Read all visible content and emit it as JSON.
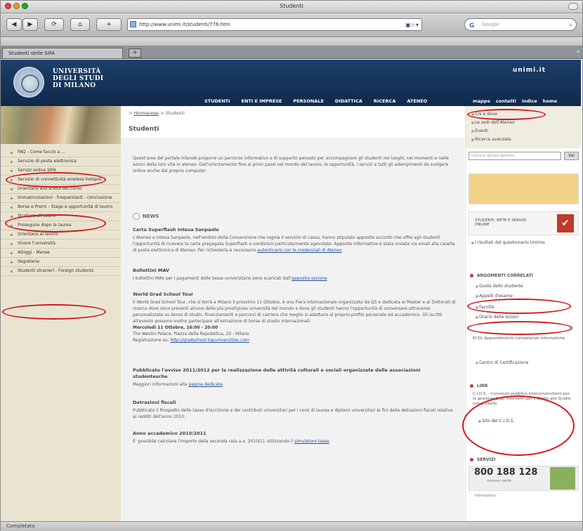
{
  "window": {
    "title": "Studenti"
  },
  "toolbar": {
    "back": "◀",
    "forward": "▶",
    "reload": "⟳",
    "home": "⌂",
    "add": "+",
    "url": "http://www.unimi.it/studenti/776.htm",
    "search_placeholder": "Google",
    "search_engine": "G"
  },
  "tab": {
    "label": "Studenti strile SIFA",
    "add": "+"
  },
  "header": {
    "university_name": [
      "UNIVERSITÀ",
      "DEGLI STUDI",
      "DI MILANO"
    ],
    "brand": "unimi.it",
    "nav": [
      "STUDENTI",
      "ENTI E IMPRESE",
      "PERSONALE",
      "DIDATTICA",
      "RICERCA",
      "ATENEO"
    ],
    "nav2": [
      "mappe",
      "contatti",
      "indice",
      "home"
    ]
  },
  "sidebar": {
    "items": [
      "FAQ - Come faccio a ...",
      "Servizio di posta elettronica",
      "Servizi online SIFA",
      "Servizio di connettività wireless hotspot",
      "Orientarsi alla scelta del corso",
      "Immatricolazioni - frequentanti - conclusione",
      "Borse e Premi - Stage e opportunità di lavoro",
      "Studiare all'estero",
      "Proseguire dopo la laurea",
      "Orientarsi al lavoro",
      "Vivere l'università",
      "Alloggi - Mense",
      "Segreterie",
      "Studenti stranieri - Foreign students"
    ]
  },
  "breadcrumb": {
    "home": "Homepage",
    "sep": ">",
    "current": "Studenti"
  },
  "page": {
    "title": "Studenti"
  },
  "intro": "Quest'area del portale intende proporre un percorso informativo e di supporto pensato per accompagnare gli studenti nei luoghi, nei momenti e nelle azioni della loro vita in ateneo. Dall'orientamento fino ai primi passi nel mondo del lavoro, le opportunità, i servizi e tutti gli adempimenti da svolgere online anche dal proprio computer.",
  "news_label": "NEWS",
  "articles": [
    {
      "title": "Carta Superflash Intesa Sanpaolo",
      "body": "L'Ateneo e Intesa Sanpaolo, nell'ambito della Convenzione che regola il servizio di cassa, hanno stipulato apposito accordo che offre agli studenti l'opportunità di ricevere la carta prepagata Superflash a condizioni particolarmente agevolate. Apposite informative è stata inviata via email alla casella di posta elettronica di Ateneo. Per richiederla è necessario",
      "link": "autenticarsi con le credenziali di Ateneo"
    },
    {
      "title": "Bollettini MAV",
      "body": "I bollettini MAV per i pagamenti delle tasse universitarie sono scaricati dall'",
      "link": "apposita sezione"
    },
    {
      "title": "World Grad School Tour",
      "body": "Il World Grad School Tour, che si terrà a Milano il prossimo 11 Ottobre, è una Fiera internazionale organizzata da QS e dedicata ai Master e ai Dottorati di ricerca dove sono presenti alcune delle più prestigiose università del mondo e dove gli studenti hanno l'opportunità di conversare attraverso personalizzate su borse di studio, finanziamenti e percorsi di carriera che meglio si adattano al proprio profilo personale ed accademico. Gli iscritti all'evento possono inoltre partecipare all'estrazione di borse di studio internazionali.",
      "extra": "Mercoledì 11 Ottobre, 16:00 - 20:00",
      "extra2": "The Westin Palace, Piazza della Repubblica, 20 - Milano",
      "extra3": "Registrazione su:",
      "link": "http://gradschool.topuniversities.com"
    },
    {
      "title": "Pubblicato l'avviso 2011/2012 per la realizzazione delle attività culturali e sociali organizzate dalle associazioni studentesche",
      "body": "Maggiori informazioni alla",
      "link": "pagina dedicata"
    },
    {
      "title": "Detrazioni fiscali",
      "body": "Pubblicato il Prospetto delle tasse d'iscrizione e dei contributi universitari per i corsi di laurea e diplomi universitari ai fini delle detrazioni fiscali relative ai redditi dell'anno 2010.",
      "link": ""
    },
    {
      "title": "Anno accademico 2010/2011",
      "body": "E' possibile calcolare l'importo della seconda rata a.a. 2010/11 utilizzando il",
      "link": "simulatore tasse"
    }
  ],
  "right": {
    "links": [
      "Chi e dove",
      "Le sedi dell'Ateneo",
      "Eventi",
      "Ricerca avanzata"
    ],
    "search_placeholder": "Cerca in questa sezione...",
    "search_button": "Vai",
    "studenti_banner": "STUDENTI, RETE E SERVIZI ONLINE",
    "questionario": "I risultati del questionario Unimia",
    "correlati_title": "ARGOMENTI CORRELATI",
    "correlati": [
      "Guida dello studente",
      "Appelli d'esame",
      "Facoltà",
      "Orario delle lezioni"
    ],
    "ecdl": "ECDL Apprendimento competenze informatiche",
    "ecdl_link": "Centro di Certificazione",
    "link_title": "LINK",
    "cilea": "C.I.D.S. - Consorzio pubblico Interuniversitario per la gestione degli interventi per il Diritto allo Studio universitario",
    "cilea_link": "Sito del C.I.D.S.",
    "servizi_title": "SERVIZI",
    "phone": "800 188 128",
    "phone_sub": "numero verde",
    "phone_caption": "informazioni"
  },
  "status": "Completato"
}
